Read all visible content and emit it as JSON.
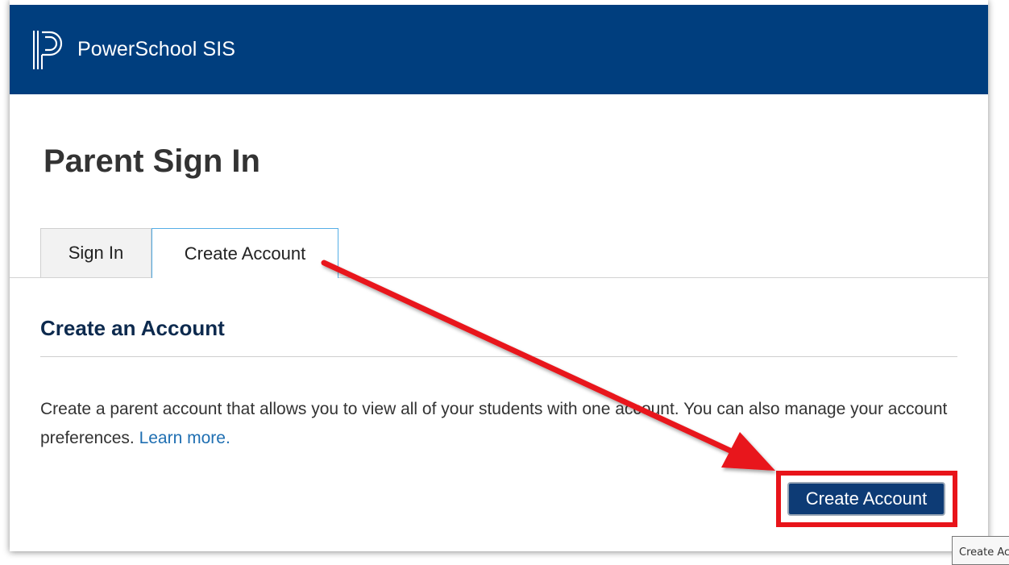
{
  "header": {
    "app_title": "PowerSchool SIS",
    "logo_icon": "powerschool-logo-icon",
    "background": "#003e7e"
  },
  "page": {
    "title": "Parent Sign In"
  },
  "tabs": [
    {
      "label": "Sign In",
      "selected": false
    },
    {
      "label": "Create Account",
      "selected": true
    }
  ],
  "section": {
    "title": "Create an Account",
    "description": "Create a parent account that allows you to view all of your students with one account. You can also manage your account preferences. ",
    "learn_more": "Learn more."
  },
  "actions": {
    "create_account_button": "Create Account"
  },
  "tooltip": {
    "text": "Create Account"
  },
  "annotation": {
    "arrow_color": "#e8141a",
    "highlight_color": "#e8141a"
  }
}
